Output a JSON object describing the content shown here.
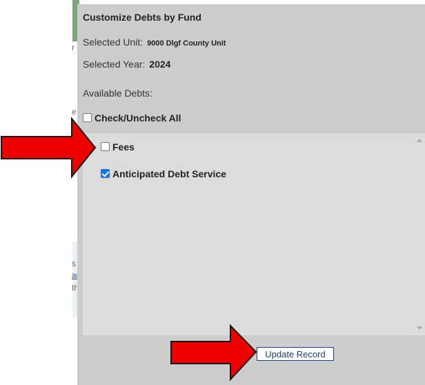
{
  "background": {
    "fragments": [
      "r",
      "e",
      "s",
      "ar",
      "th"
    ]
  },
  "dialog": {
    "title": "Customize Debts by Fund",
    "unit_label": "Selected Unit:",
    "unit_value": "9000 Dlgf County Unit",
    "year_label": "Selected Year:",
    "year_value": "2024",
    "available_label": "Available Debts:",
    "check_all_label": "Check/Uncheck All",
    "debts": [
      {
        "label": "Fees",
        "checked": false
      },
      {
        "label": "Anticipated Debt Service",
        "checked": true
      }
    ],
    "update_button": "Update Record"
  },
  "colors": {
    "dialog_bg": "#cdcdcd",
    "list_bg": "#dcdcdc",
    "arrow": "#ee0000",
    "check_accent": "#1a73e8"
  }
}
